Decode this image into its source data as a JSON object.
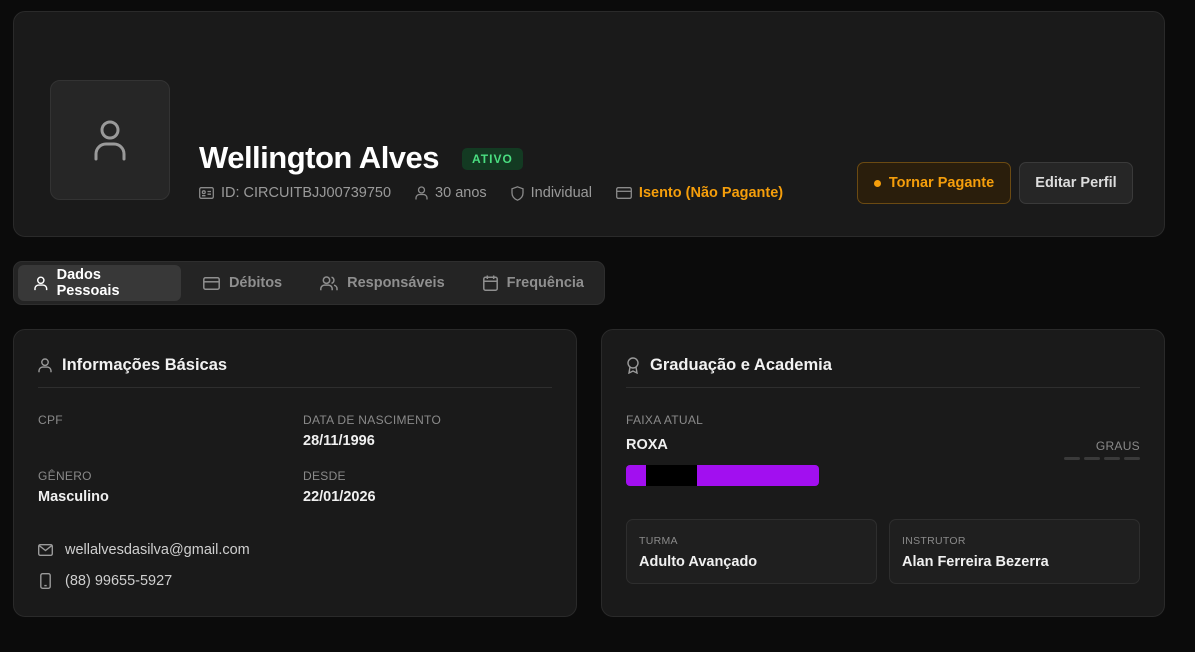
{
  "profile": {
    "name": "Wellington Alves",
    "status": "ATIVO",
    "id_text": "ID: CIRCUITBJJ00739750",
    "age": "30 anos",
    "plan": "Individual",
    "payment": "Isento (Não Pagante)",
    "make_paying_label": "Tornar Pagante",
    "edit_label": "Editar Perfil"
  },
  "tabs": [
    {
      "label": "Dados Pessoais",
      "icon": "user-icon",
      "active": true
    },
    {
      "label": "Débitos",
      "icon": "card-icon",
      "active": false
    },
    {
      "label": "Responsáveis",
      "icon": "users-icon",
      "active": false
    },
    {
      "label": "Frequência",
      "icon": "calendar-icon",
      "active": false
    }
  ],
  "basic_info": {
    "title": "Informações Básicas",
    "cpf_label": "CPF",
    "cpf_value": "",
    "birth_label": "DATA DE NASCIMENTO",
    "birth_value": "28/11/1996",
    "gender_label": "GÊNERO",
    "gender_value": "Masculino",
    "since_label": "DESDE",
    "since_value": "22/01/2026",
    "email": "wellalvesdasilva@gmail.com",
    "phone": "(88) 99655-5927"
  },
  "graduation": {
    "title": "Graduação e Academia",
    "belt_label": "FAIXA ATUAL",
    "belt_value": "ROXA",
    "degrees_label": "GRAUS",
    "class_label": "TURMA",
    "class_value": "Adulto Avançado",
    "instructor_label": "INSTRUTOR",
    "instructor_value": "Alan Ferreira Bezerra"
  },
  "colors": {
    "accent": "#f59e0b",
    "status_green": "#4ade80",
    "belt_purple": "#a20ff0"
  }
}
